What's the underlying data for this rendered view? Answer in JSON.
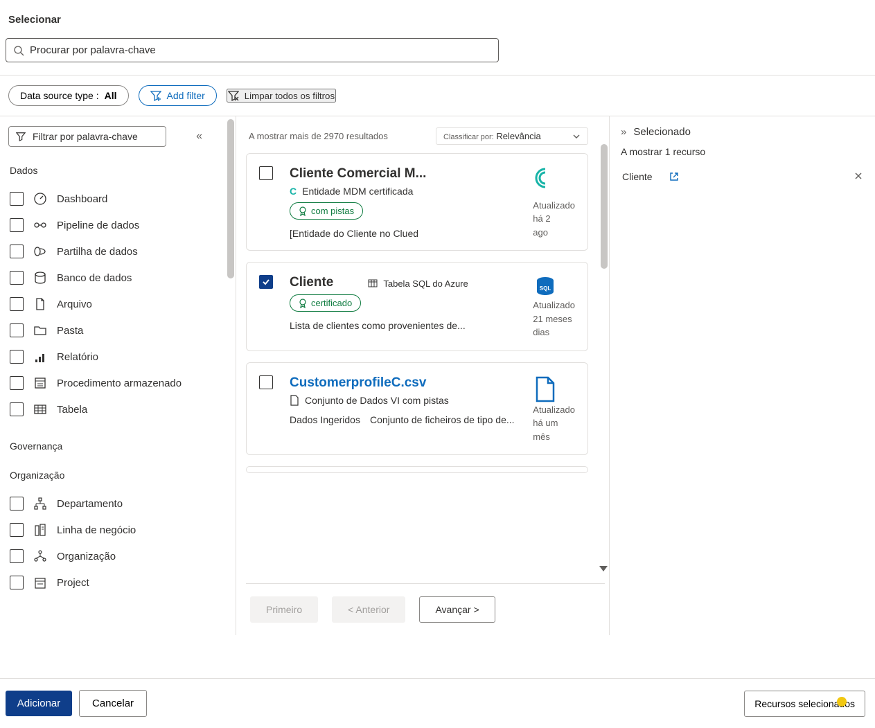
{
  "header": {
    "title": "Selecionar",
    "search_placeholder": "Procurar por palavra-chave"
  },
  "filter_bar": {
    "data_source_label": "Data source type : ",
    "data_source_value": "All",
    "add_filter": "Add filter",
    "clear_filters": "Limpar todos os filtros"
  },
  "sidebar": {
    "filter_placeholder": "Filtrar por palavra-chave",
    "sections": {
      "dados": "Dados",
      "governanca": "Governança",
      "organizacao": "Organização"
    },
    "dados_items": [
      {
        "label": "Dashboard",
        "icon": "gauge-icon"
      },
      {
        "label": "Pipeline de dados",
        "icon": "pipeline-icon"
      },
      {
        "label": "Partilha de dados",
        "icon": "share-icon"
      },
      {
        "label": "Banco de dados",
        "icon": "database-icon"
      },
      {
        "label": "Arquivo",
        "icon": "file-icon"
      },
      {
        "label": "Pasta",
        "icon": "folder-icon"
      },
      {
        "label": "Relatório",
        "icon": "report-icon"
      },
      {
        "label": "Procedimento armazenado",
        "icon": "storedproc-icon"
      },
      {
        "label": "Tabela",
        "icon": "table-icon"
      }
    ],
    "org_items": [
      {
        "label": "Departamento",
        "icon": "department-icon"
      },
      {
        "label": "Linha de negócio",
        "icon": "lob-icon"
      },
      {
        "label": "Organização",
        "icon": "org-icon"
      },
      {
        "label": "Project",
        "icon": "project-icon"
      }
    ]
  },
  "results": {
    "count_text": "A mostrar mais de 2970 resultados",
    "sort_label": "Classificar por:",
    "sort_value": "Relevância",
    "cards": [
      {
        "checked": false,
        "title": "Cliente Comercial M...",
        "subtype": "Entidade MDM certificada",
        "badge": "com pistas",
        "desc": "[Entidade do Cliente no Clued",
        "updated1": "Atualizado",
        "updated2": "há 2",
        "updated3": "ago"
      },
      {
        "checked": true,
        "title": "Cliente",
        "type_text": "Tabela SQL do Azure",
        "badge": "certificado",
        "desc": "Lista de clientes como provenientes de...",
        "updated1": "Atualizado",
        "updated2": "21 meses",
        "updated3": "dias"
      },
      {
        "checked": false,
        "title": "CustomerprofileC.csv",
        "title_link": true,
        "subtype": "Conjunto de Dados VI com pistas",
        "desc1": "Dados Ingeridos",
        "desc2": "Conjunto de ficheiros de tipo de...",
        "updated1": "Atualizado",
        "updated2": "há um mês"
      }
    ],
    "pager": {
      "first": "Primeiro",
      "prev": "<  Anterior",
      "next": "Avançar >"
    }
  },
  "selected": {
    "heading": "Selecionado",
    "count": "A mostrar 1 recurso",
    "items": [
      {
        "name": "Cliente"
      }
    ]
  },
  "footer": {
    "add": "Adicionar",
    "cancel": "Cancelar",
    "right": "Recursos selecionados"
  }
}
